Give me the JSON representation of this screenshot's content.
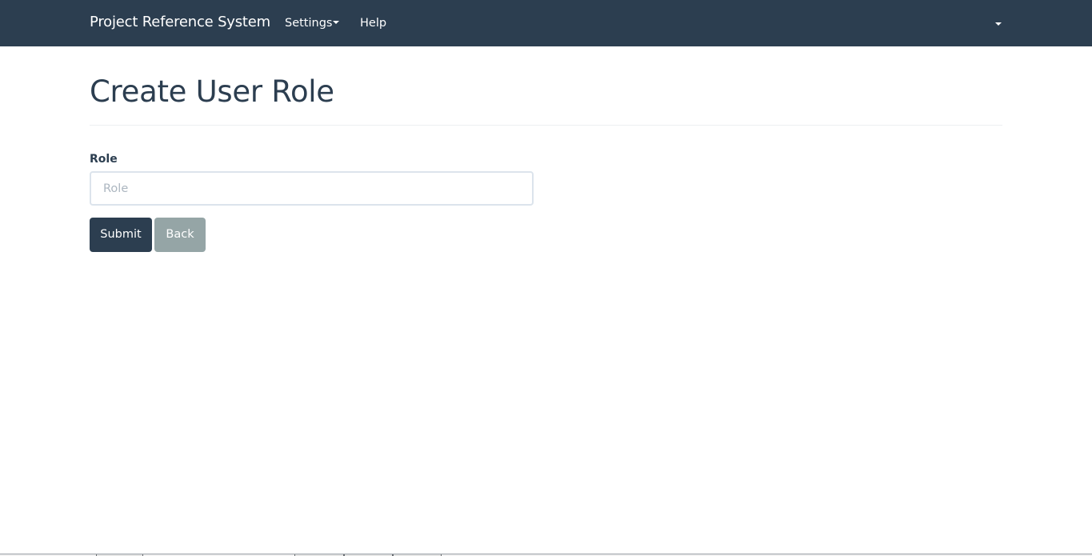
{
  "navbar": {
    "brand": "Project Reference System",
    "settings_label": "Settings",
    "help_label": "Help",
    "user_menu_label": ""
  },
  "page": {
    "title": "Create User Role"
  },
  "form": {
    "role_label": "Role",
    "role_value": "",
    "role_placeholder": "Role",
    "submit_label": "Submit",
    "back_label": "Back"
  },
  "colors": {
    "primary": "#2c3e50",
    "secondary": "#95a5a6",
    "input_border": "#dce4ec",
    "placeholder": "#acb6c0"
  }
}
